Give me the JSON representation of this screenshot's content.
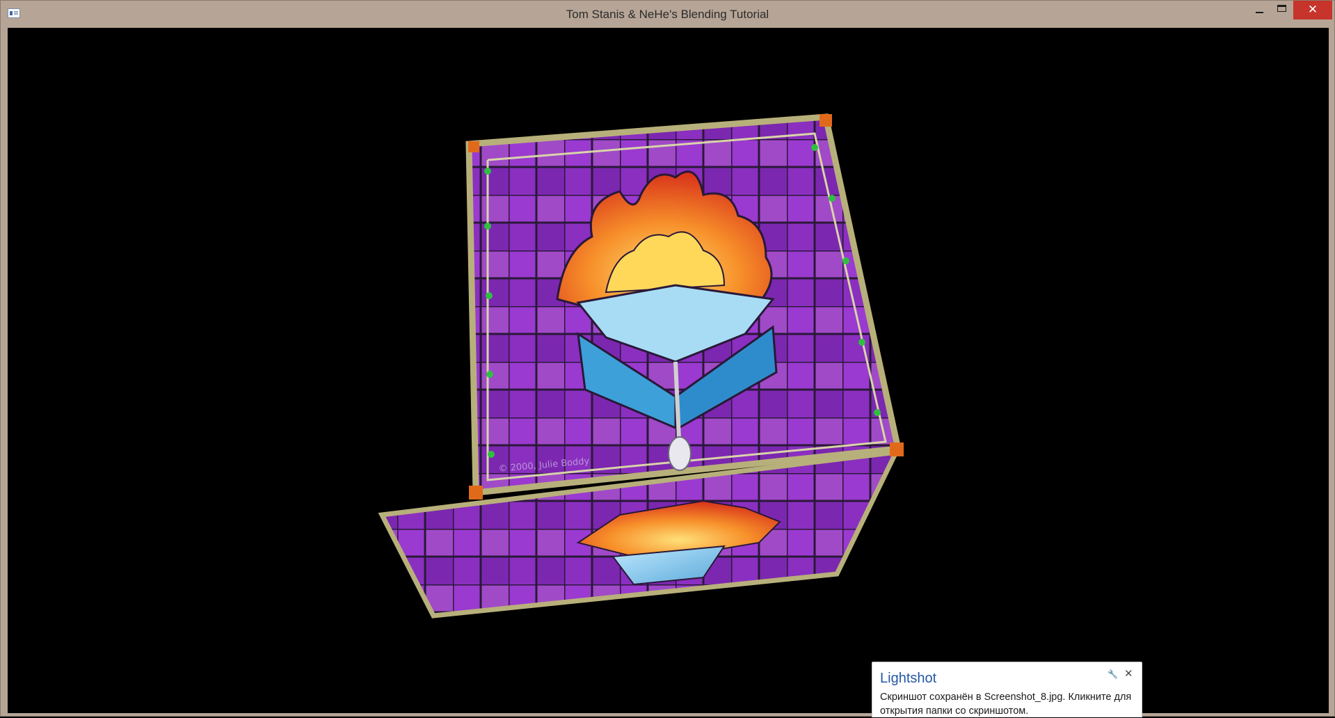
{
  "window": {
    "title": "Tom Stanis & NeHe's Blending Tutorial",
    "close_glyph": "✕",
    "icon": "app-window-icon",
    "close_color": "#c7342b"
  },
  "scene": {
    "description_icon": "stained-glass-cube",
    "texture_signature": "© 2000, Julie Boddy",
    "colors": {
      "background": "#000000",
      "glass_purple": "#8a2fc0",
      "flame_orange": "#f06a1e",
      "drop_blue": "#5ec0ee",
      "frame_gold": "#b8b07a"
    }
  },
  "notification": {
    "title": "Lightshot",
    "message": "Скриншот сохранён в Screenshot_8.jpg. Кликните для открытия папки со скриншотом.",
    "close_glyph": "✕",
    "settings_glyph": "🔧",
    "title_color": "#2457a6"
  }
}
